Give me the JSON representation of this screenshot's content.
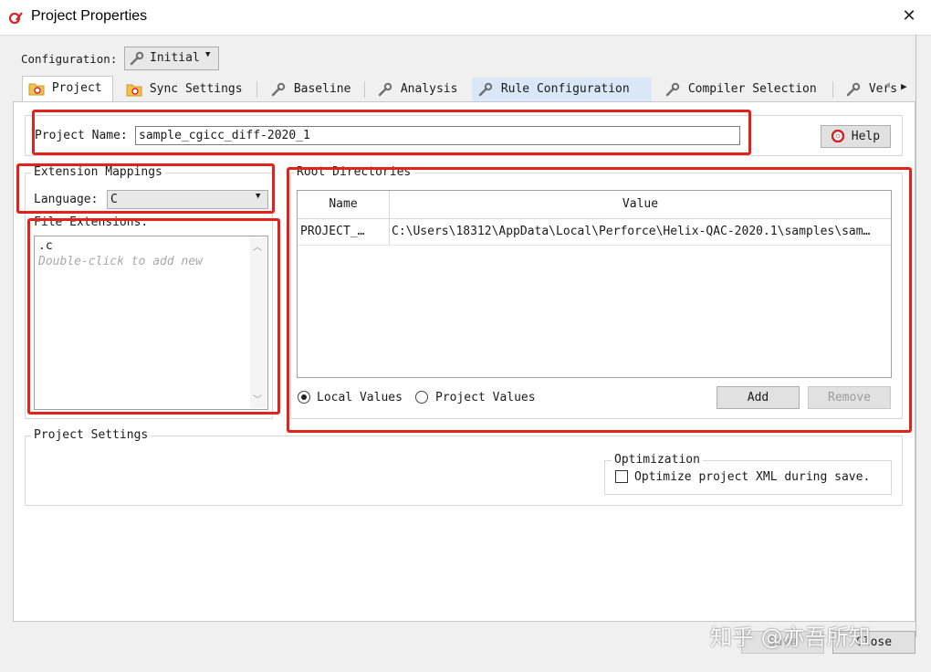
{
  "window": {
    "title": "Project Properties",
    "close_glyph": "✕"
  },
  "configuration": {
    "label": "Configuration:",
    "value": "Initial"
  },
  "tabs": [
    {
      "label": "Project",
      "icon": "project-folder-icon",
      "state": "active"
    },
    {
      "label": "Sync Settings",
      "icon": "sync-folder-icon",
      "state": "normal"
    },
    {
      "label": "Baseline",
      "icon": "wrench-icon",
      "state": "normal"
    },
    {
      "label": "Analysis",
      "icon": "wrench-icon",
      "state": "normal"
    },
    {
      "label": "Rule Configuration",
      "icon": "wrench-icon",
      "state": "hover"
    },
    {
      "label": "Compiler Selection",
      "icon": "wrench-icon",
      "state": "normal"
    },
    {
      "label": "Version",
      "icon": "wrench-icon",
      "state": "normal"
    }
  ],
  "project": {
    "name_label": "Project Name:",
    "name_value": "sample_cgicc_diff-2020_1",
    "help_label": "Help"
  },
  "extension_mappings": {
    "title": "Extension Mappings",
    "language_label": "Language:",
    "language_value": "C",
    "file_extensions_title": "File Extensions:",
    "extensions": [
      ".c"
    ],
    "add_hint": "Double-click to add new"
  },
  "root_directories": {
    "title": "Root Directories",
    "columns": [
      "Name",
      "Value"
    ],
    "rows": [
      {
        "name": "PROJECT_…",
        "value": "C:\\Users\\18312\\AppData\\Local\\Perforce\\Helix-QAC-2020.1\\samples\\sam…"
      }
    ],
    "local_values_label": "Local Values",
    "project_values_label": "Project Values",
    "selected": "local",
    "add_label": "Add",
    "remove_label": "Remove"
  },
  "project_settings": {
    "title": "Project Settings",
    "optimization_title": "Optimization",
    "optimize_label": "Optimize project XML during save.",
    "optimize_checked": false
  },
  "footer": {
    "save_label": "Save",
    "close_label": "Close"
  },
  "watermark": "知乎 @亦吾所知",
  "colors": {
    "highlight_border": "#e0231d",
    "tab_hover": "#d9e7f6",
    "window_bg": "#f0f0f0"
  }
}
